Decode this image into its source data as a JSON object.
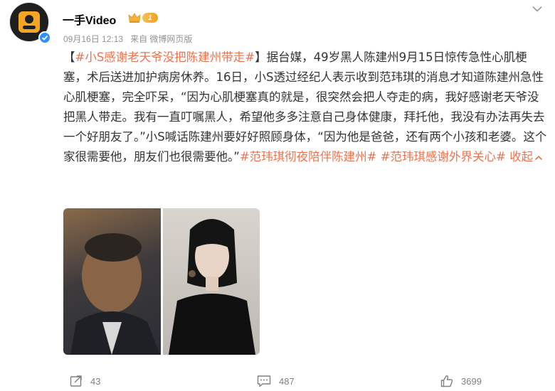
{
  "header": {
    "user_name": "一手Video",
    "vip_level": "1",
    "date": "09月16日",
    "time": "12:13",
    "source": "来自 微博网页版"
  },
  "post": {
    "segments": [
      {
        "text": "【",
        "type": "text"
      },
      {
        "text": "#小S感谢老天爷没把陈建州带走#",
        "type": "hashtag"
      },
      {
        "text": "】据台媒，49岁黑人陈建州9月15日惊传急性心肌梗塞，术后送进加护病房休养。16日，小S透过经纪人表示收到范玮琪的消息才知道陈建州急性心肌梗塞，完全吓呆，“因为心肌梗塞真的就是，很突然会把人夺走的病，我好感谢老天爷没把黑人带走。我有一直叮嘱黑人，希望他多多注意自己身体健康，拜托他，我没有办法再失去一个好朋友了。”小S喊话陈建州要好好照顾身体，“因为他是爸爸，还有两个小孩和老婆。这个家很需要他，朋友们也很需要他。”",
        "type": "text"
      },
      {
        "text": "#范玮琪彻夜陪伴陈建州#",
        "type": "hashtag"
      },
      {
        "text": " ",
        "type": "text"
      },
      {
        "text": "#范玮琪感谢外界关心#",
        "type": "hashtag"
      },
      {
        "text": " ",
        "type": "text"
      }
    ],
    "collapse_label": "收起"
  },
  "actions": {
    "forward_count": "43",
    "comment_count": "487",
    "like_count": "3699"
  },
  "colors": {
    "accent": "#eb7350",
    "meta": "#939393",
    "verified": "#2f8fff"
  },
  "icons": [
    "more-chevron-icon",
    "verified-icon",
    "crown-icon",
    "forward-icon",
    "comment-icon",
    "like-icon",
    "chevron-up-icon"
  ]
}
